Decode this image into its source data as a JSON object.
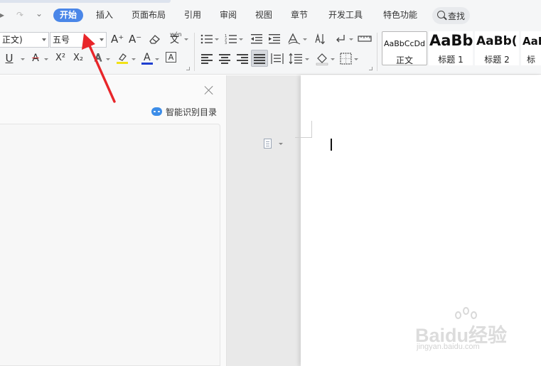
{
  "menubar": {
    "quick_redo_icon": "↷",
    "quick_more_icon": "⌄",
    "tabs": [
      "开始",
      "插入",
      "页面布局",
      "引用",
      "审阅",
      "视图",
      "章节",
      "开发工具",
      "特色功能"
    ],
    "active_tab": "开始",
    "search_label": "查找"
  },
  "ribbon": {
    "font_name": "正文)",
    "font_size": "五号",
    "increase_font_icon": "A⁺",
    "decrease_font_icon": "A⁻",
    "clear_format_icon": "eraser",
    "phonetic_guide_icon": "文",
    "phonetic_guide_text": "wén",
    "underline_icon": "U",
    "strikethrough_icon": "A",
    "superscript_icon": "X²",
    "subscript_icon": "X₂",
    "text_effect_icon": "A",
    "highlight_icon": "highlighter",
    "font_color_icon": "A",
    "char_border_icon": "A",
    "colors": {
      "highlight": "#f2e216",
      "font_color": "#1f3fd0",
      "active_tab": "#4a86e8"
    },
    "styles": [
      {
        "sample": "AaBbCcDd",
        "name": "正文"
      },
      {
        "sample": "AaBb",
        "name": "标题 1"
      },
      {
        "sample": "AaBb(",
        "name": "标题 2"
      },
      {
        "sample": "AaB",
        "name": "标"
      }
    ]
  },
  "left_panel": {
    "smart_toc_label": "智能识别目录"
  },
  "watermark": {
    "logo": "Baidu经验",
    "url": "jingyan.baidu.com"
  }
}
